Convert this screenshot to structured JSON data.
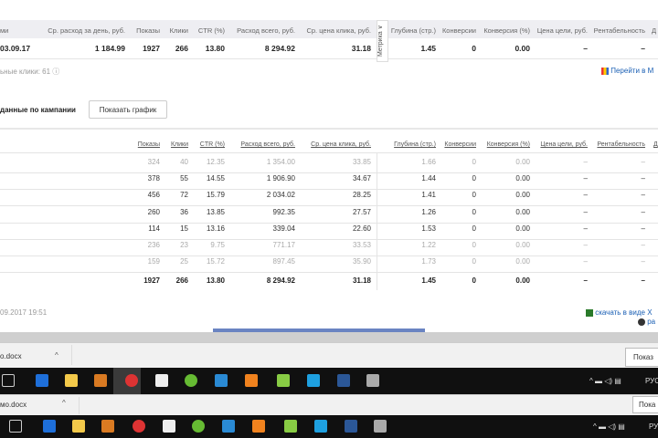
{
  "summary": {
    "headers": [
      "ми",
      "Ср. расход за день, руб.",
      "Показы",
      "Клики",
      "CTR (%)",
      "Расход всего, руб.",
      "Ср. цена клика, руб.",
      "Глубина (стр.)",
      "Конверсии",
      "Конверсия (%)",
      "Цена цели, руб.",
      "Рентабельность",
      "Д"
    ],
    "row": [
      "03.09.17",
      "1 184.99",
      "1927",
      "266",
      "13.80",
      "8 294.92",
      "31.18",
      "1.45",
      "0",
      "0.00",
      "–",
      "–"
    ],
    "metrika_tab": "Метрика ∨",
    "clicks_note": "ьные клики: 61",
    "help_icon": "ⓘ",
    "metrika_link": "Перейти в М"
  },
  "campaign": {
    "title": "данные по кампании",
    "show_chart_button": "Показать график",
    "headers": [
      "Показы",
      "Клики",
      "CTR (%)",
      "Расход всего, руб.",
      "Ср. цена клика, руб.",
      "Глубина (стр.)",
      "Конверсии",
      "Конверсия (%)",
      "Цена цели, руб.",
      "Рентабельность",
      "Д"
    ],
    "rows": [
      {
        "dim": true,
        "cells": [
          "324",
          "40",
          "12.35",
          "1 354.00",
          "33.85",
          "1.66",
          "0",
          "0.00",
          "–",
          "–"
        ]
      },
      {
        "dim": false,
        "cells": [
          "378",
          "55",
          "14.55",
          "1 906.90",
          "34.67",
          "1.44",
          "0",
          "0.00",
          "–",
          "–"
        ]
      },
      {
        "dim": false,
        "cells": [
          "456",
          "72",
          "15.79",
          "2 034.02",
          "28.25",
          "1.41",
          "0",
          "0.00",
          "–",
          "–"
        ]
      },
      {
        "dim": false,
        "cells": [
          "260",
          "36",
          "13.85",
          "992.35",
          "27.57",
          "1.26",
          "0",
          "0.00",
          "–",
          "–"
        ]
      },
      {
        "dim": false,
        "cells": [
          "114",
          "15",
          "13.16",
          "339.04",
          "22.60",
          "1.53",
          "0",
          "0.00",
          "–",
          "–"
        ]
      },
      {
        "dim": true,
        "cells": [
          "236",
          "23",
          "9.75",
          "771.17",
          "33.53",
          "1.22",
          "0",
          "0.00",
          "–",
          "–"
        ]
      },
      {
        "dim": true,
        "cells": [
          "159",
          "25",
          "15.72",
          "897.45",
          "35.90",
          "1.73",
          "0",
          "0.00",
          "–",
          "–"
        ]
      }
    ],
    "total": [
      "1927",
      "266",
      "13.80",
      "8 294.92",
      "31.18",
      "1.45",
      "0",
      "0.00",
      "–",
      "–"
    ]
  },
  "footer": {
    "timestamp": "09.2017 19:51",
    "download_link": "скачать в виде X",
    "print_link": "ра"
  },
  "downloads": [
    {
      "file": "o.docx",
      "chevron": "^",
      "button": "Показ"
    },
    {
      "file": "мо.docx",
      "chevron": "^",
      "button": "Пока"
    }
  ],
  "taskbar": {
    "language": "РУС",
    "tray": "^ ▬ ◁) ▤"
  },
  "colors": {
    "accent": "#1a5fb4",
    "taskbar": "#101010"
  }
}
